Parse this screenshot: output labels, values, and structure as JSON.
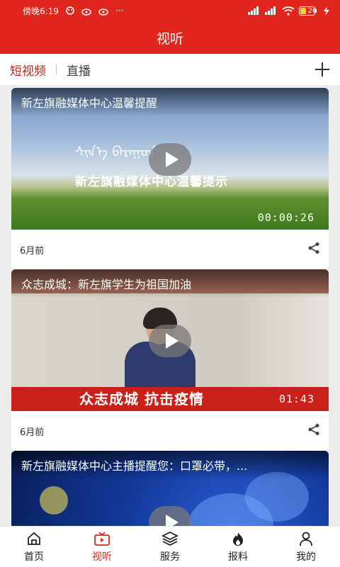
{
  "status_bar": {
    "time": "傍晚6:19",
    "dots": "···",
    "battery": "26"
  },
  "header": {
    "title": "视听"
  },
  "tabs": [
    {
      "label": "短视频",
      "active": true
    },
    {
      "label": "直播",
      "active": false
    }
  ],
  "videos": [
    {
      "title": "新左旗融媒体中心温馨提醒",
      "overlay_caption": "新左旗融媒体中心温馨提示",
      "duration": "00:00:26",
      "age": "6月前"
    },
    {
      "title": "众志成城：新左旗学生为祖国加油",
      "overlay_caption": "众志成城  抗击疫情",
      "duration": "01:43",
      "age": "6月前"
    },
    {
      "title": "新左旗融媒体中心主播提醒您：口罩必带，...",
      "duration": "",
      "age": ""
    }
  ],
  "bottom_nav": [
    {
      "label": "首页",
      "icon": "home-icon",
      "active": false
    },
    {
      "label": "视听",
      "icon": "tv-icon",
      "active": true
    },
    {
      "label": "服务",
      "icon": "layers-icon",
      "active": false
    },
    {
      "label": "报料",
      "icon": "flame-icon",
      "active": false
    },
    {
      "label": "我的",
      "icon": "user-icon",
      "active": false
    }
  ],
  "colors": {
    "brand": "#e0261f",
    "active_tab": "#b3261e"
  }
}
